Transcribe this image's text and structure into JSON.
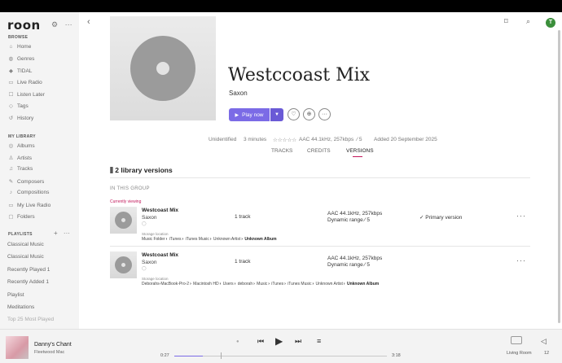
{
  "sidebar": {
    "logo": "roon",
    "browse_title": "BROWSE",
    "browse_items": [
      {
        "label": "Home",
        "icon": "home-icon"
      },
      {
        "label": "Genres",
        "icon": "genres-icon"
      },
      {
        "label": "TIDAL",
        "icon": "tidal-icon"
      },
      {
        "label": "Live Radio",
        "icon": "radio-icon"
      },
      {
        "label": "Listen Later",
        "icon": "listen-later-icon"
      },
      {
        "label": "Tags",
        "icon": "tag-icon"
      },
      {
        "label": "History",
        "icon": "history-icon"
      }
    ],
    "library_title": "MY LIBRARY",
    "library_items": [
      {
        "label": "Albums",
        "icon": "album-icon"
      },
      {
        "label": "Artists",
        "icon": "artist-icon"
      },
      {
        "label": "Tracks",
        "icon": "track-icon"
      },
      {
        "label": "Composers",
        "icon": "composer-icon"
      },
      {
        "label": "Compositions",
        "icon": "composition-icon"
      },
      {
        "label": "My Live Radio",
        "icon": "radio-icon"
      },
      {
        "label": "Folders",
        "icon": "folder-icon"
      }
    ],
    "playlists_title": "PLAYLISTS",
    "playlists": [
      "Classical Music",
      "Classical Music",
      "Recently Played 1",
      "Recently Added 1",
      "Playlist",
      "Meditations",
      "Top 25 Most Played"
    ]
  },
  "album": {
    "title": "Westccoast Mix",
    "artist": "Saxon",
    "play_label": "Play now",
    "meta": {
      "status": "Unidentified",
      "duration": "3 minutes",
      "rating": "☆☆☆☆☆",
      "format": "AAC 44.1kHz, 257kbps",
      "dynamic": "5",
      "added": "Added 20 September 2025"
    },
    "tabs": [
      "TRACKS",
      "CREDITS",
      "VERSIONS"
    ],
    "active_tab": "VERSIONS"
  },
  "versions": {
    "title": "2 library versions",
    "group_label": "IN THIS GROUP",
    "current_label": "Currently viewing",
    "storage_label": "Storage location",
    "items": [
      {
        "name": "Westcoast Mix",
        "artist": "Saxon",
        "tracks": "1 track",
        "format": "AAC 44.1kHz, 257kbps",
        "dynamic": "Dynamic range ⁄ 5",
        "primary": "✓ Primary version",
        "path": [
          "Music Folder",
          "iTunes",
          "iTunes Music",
          "Unknown Artist"
        ],
        "path_last": "Unknown Album"
      },
      {
        "name": "Westcoast Mix",
        "artist": "Saxon",
        "tracks": "1 track",
        "format": "AAC 44.1kHz, 257kbps",
        "dynamic": "Dynamic range ⁄ 5",
        "primary": "",
        "path": [
          "Deborahs-MacBook-Pro-2",
          "Macintosh HD",
          "Users",
          "deborah",
          "Music",
          "iTunes",
          "iTunes Music",
          "Unknown Artist"
        ],
        "path_last": "Unknown Album"
      }
    ]
  },
  "player": {
    "title": "Danny's Chant",
    "artist": "Fleetwood Mac",
    "elapsed": "0:27",
    "total": "3:18",
    "progress": 0.136,
    "zone": "Living Room",
    "volume": "12",
    "accent": "#7b6be6"
  }
}
